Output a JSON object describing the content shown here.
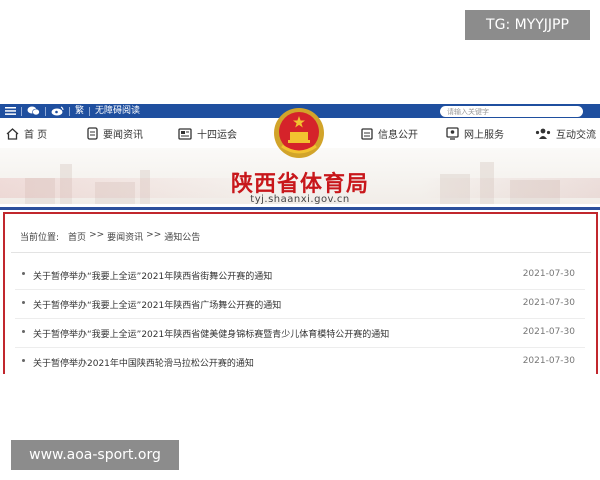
{
  "watermark_top": "TG: MYYJJPP",
  "watermark_bottom": "www.aoa-sport.org",
  "topbar": {
    "traditional": "繁",
    "accessible": "无障碍阅读",
    "search_placeholder": "请输入关键字"
  },
  "nav": {
    "home": "首 页",
    "news": "要闻资讯",
    "games": "十四运会",
    "info": "信息公开",
    "service": "网上服务",
    "interact": "互动交流"
  },
  "header": {
    "title": "陕西省体育局",
    "domain": "tyj.shaanxi.gov.cn"
  },
  "breadcrumb": {
    "label": "当前位置:",
    "home": "首页",
    "sep1": ">>",
    "news": "要闻资讯",
    "sep2": ">>",
    "notice": "通知公告"
  },
  "notices": [
    {
      "title": "关于暂停举办“我要上全运”2021年陕西省街舞公开赛的通知",
      "date": "2021-07-30"
    },
    {
      "title": "关于暂停举办“我要上全运”2021年陕西省广场舞公开赛的通知",
      "date": "2021-07-30"
    },
    {
      "title": "关于暂停举办“我要上全运”2021年陕西省健美健身锦标赛暨青少儿体育模特公开赛的通知",
      "date": "2021-07-30"
    },
    {
      "title": "关于暂停举办2021年中国陕西轮滑马拉松公开赛的通知",
      "date": "2021-07-30"
    }
  ],
  "colors": {
    "brand_red": "#c8171b",
    "brand_blue": "#1f4f9f"
  }
}
